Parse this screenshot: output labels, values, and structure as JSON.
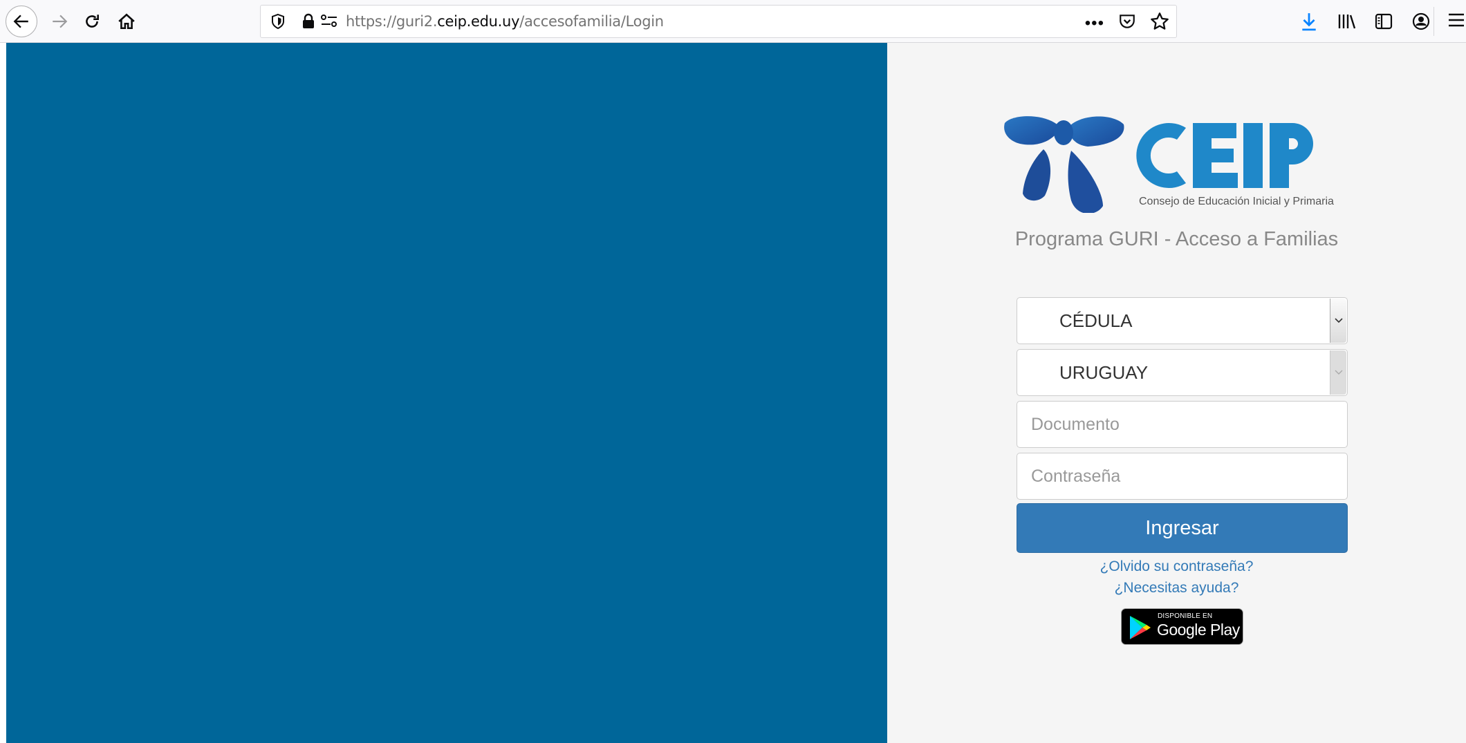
{
  "browser": {
    "url_prefix": "https://guri2.",
    "url_domain": "ceip.edu.uy",
    "url_path": "/accesofamilia/Login",
    "icons": [
      "back-icon",
      "forward-icon",
      "reload-icon",
      "home-icon",
      "tracking-shield-icon",
      "lock-icon",
      "permissions-icon",
      "page-actions-icon",
      "pocket-icon",
      "bookmark-star-icon",
      "download-icon",
      "library-icon",
      "sidebar-icon",
      "account-icon",
      "menu-icon"
    ],
    "accent_color": "#0a84ff"
  },
  "logo": {
    "text": "CEIP",
    "subtitle": "Consejo de Educación Inicial y Primaria"
  },
  "login": {
    "program_title": "Programa GURI - Acceso a Familias",
    "document_type": "CÉDULA",
    "country": "URUGUAY",
    "document_placeholder": "Documento",
    "password_placeholder": "Contraseña",
    "submit_label": "Ingresar",
    "forgot_password": "¿Olvido su contraseña?",
    "help": "¿Necesitas ayuda?",
    "google_play_small": "DISPONIBLE EN",
    "google_play_big": "Google Play"
  },
  "colors": {
    "left_panel": "#006699",
    "right_panel": "#f5f5f5",
    "brand_blue": "#1f88c9",
    "button": "#337ab7"
  }
}
